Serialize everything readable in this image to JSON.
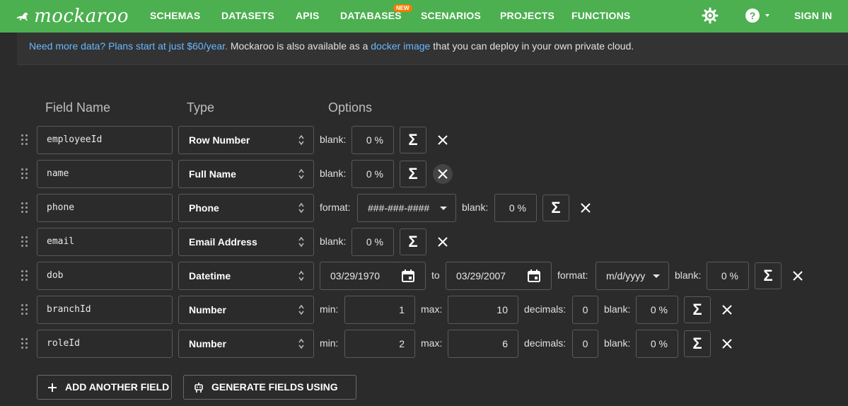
{
  "nav": {
    "logo": "mockaroo",
    "items": [
      "SCHEMAS",
      "DATASETS",
      "APIS",
      "DATABASES",
      "SCENARIOS",
      "PROJECTS",
      "FUNCTIONS"
    ],
    "badge": "NEW",
    "signin": "SIGN IN"
  },
  "banner": {
    "link1": "Need more data? Plans start at just $60/year.",
    "text1": " Mockaroo is also available as a ",
    "link2": "docker image",
    "text2": " that you can deploy in your own private cloud."
  },
  "headers": {
    "field_name": "Field Name",
    "type": "Type",
    "options": "Options"
  },
  "fields": [
    {
      "name": "employeeId",
      "type": "Row Number",
      "blank_label": "blank:",
      "blank": "0 %"
    },
    {
      "name": "name",
      "type": "Full Name",
      "blank_label": "blank:",
      "blank": "0 %"
    },
    {
      "name": "phone",
      "type": "Phone",
      "format_label": "format:",
      "format": "###-###-####",
      "blank_label": "blank:",
      "blank": "0 %"
    },
    {
      "name": "email",
      "type": "Email Address",
      "blank_label": "blank:",
      "blank": "0 %"
    },
    {
      "name": "dob",
      "type": "Datetime",
      "from": "03/29/1970",
      "to_label": "to",
      "to": "03/29/2007",
      "format_label": "format:",
      "format": "m/d/yyyy",
      "blank_label": "blank:",
      "blank": "0 %"
    },
    {
      "name": "branchId",
      "type": "Number",
      "min_label": "min:",
      "min": "1",
      "max_label": "max:",
      "max": "10",
      "decimals_label": "decimals:",
      "decimals": "0",
      "blank_label": "blank:",
      "blank": "0 %"
    },
    {
      "name": "roleId",
      "type": "Number",
      "min_label": "min:",
      "min": "2",
      "max_label": "max:",
      "max": "6",
      "decimals_label": "decimals:",
      "decimals": "0",
      "blank_label": "blank:",
      "blank": "0 %"
    }
  ],
  "sigma_symbol": "Σ",
  "buttons": {
    "add_field": "ADD ANOTHER FIELD",
    "generate_ai": "GENERATE FIELDS USING AI..."
  },
  "colors": {
    "nav_green": "#4caf50",
    "background": "#2b2b2b",
    "link_blue": "#6ab7ff",
    "badge_orange": "#f57c00"
  }
}
